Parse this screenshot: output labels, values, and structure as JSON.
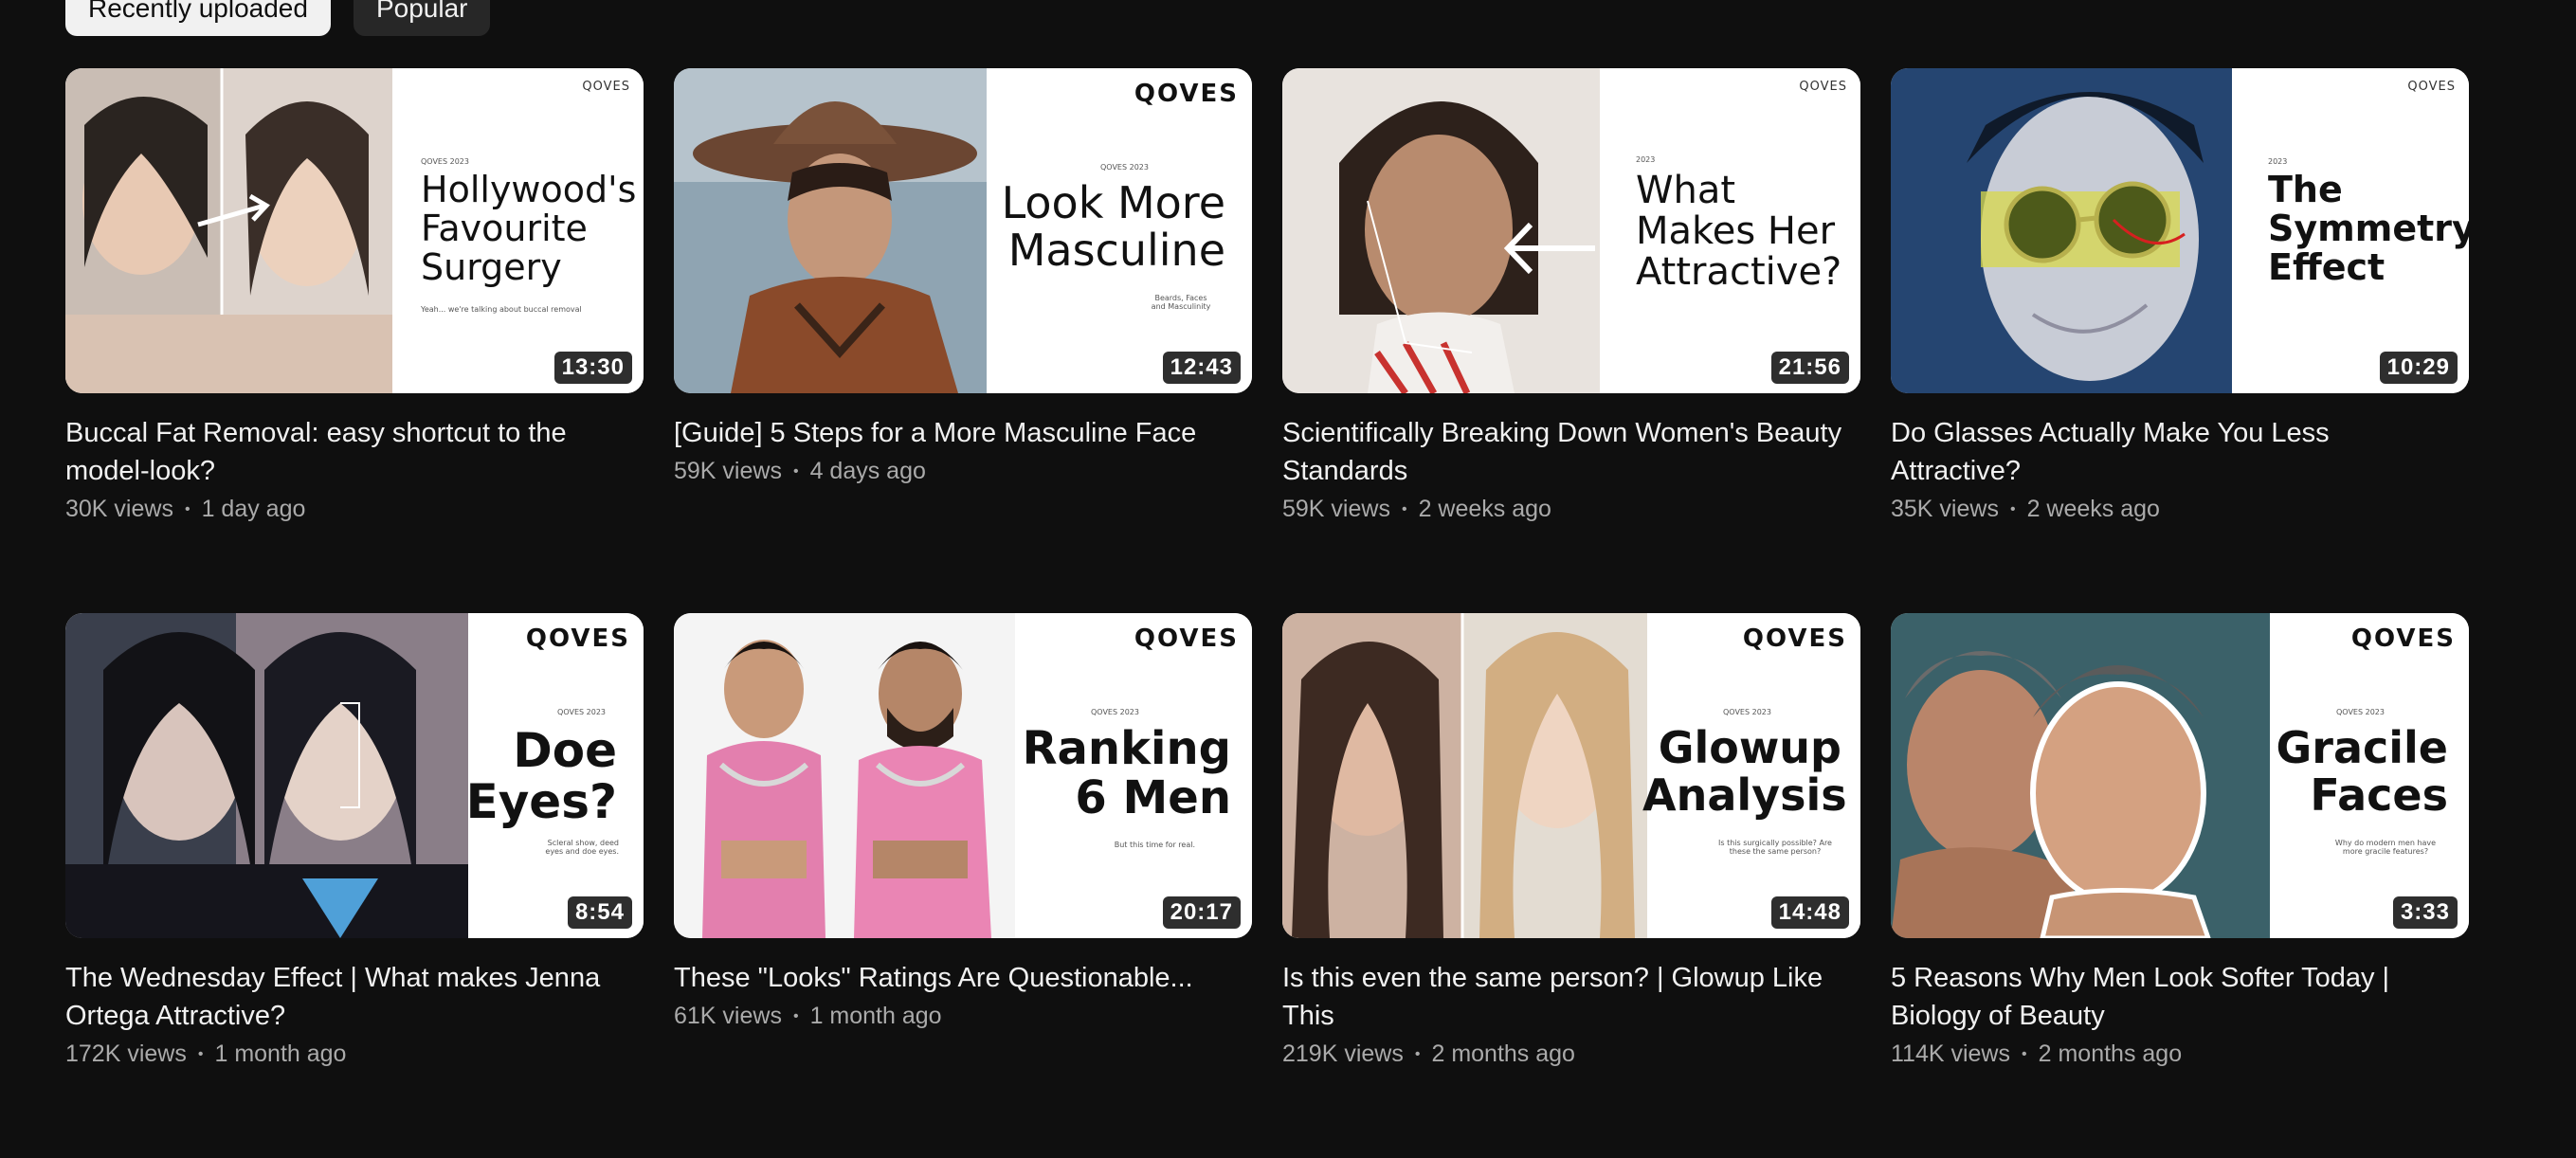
{
  "chips": [
    {
      "label": "Recently uploaded",
      "active": true
    },
    {
      "label": "Popular",
      "active": false
    }
  ],
  "videos": [
    {
      "title": "Buccal Fat Removal: easy shortcut to the model-look?",
      "views": "30K views",
      "age": "1 day ago",
      "duration": "13:30",
      "brand": "QOVES",
      "thumb_text": "Hollywood's Favourite Surgery",
      "thumb_small": "QOVES 2023",
      "thumb_caption": "Yeah... we're talking about buccal removal",
      "photo_color": "#b9a496"
    },
    {
      "title": "[Guide] 5 Steps for a More Masculine Face",
      "views": "59K views",
      "age": "4 days ago",
      "duration": "12:43",
      "brand": "QOVES",
      "thumb_text": "Look More Masculine",
      "thumb_small": "QOVES 2023",
      "thumb_caption": "Beards, Faces and Masculinity",
      "photo_color": "#6e5a4a"
    },
    {
      "title": "Scientifically Breaking Down Women's Beauty Standards",
      "views": "59K views",
      "age": "2 weeks ago",
      "duration": "21:56",
      "brand": "QOVES",
      "thumb_text": "What Makes Her Attractive?",
      "thumb_small": "2023",
      "thumb_caption": "",
      "photo_color": "#cdb7a4"
    },
    {
      "title": "Do Glasses Actually Make You Less Attractive?",
      "views": "35K views",
      "age": "2 weeks ago",
      "duration": "10:29",
      "brand": "QOVES",
      "thumb_text": "The Symmetry Effect",
      "thumb_small": "2023",
      "thumb_caption": "",
      "photo_color": "#2d4e7a"
    },
    {
      "title": "The Wednesday Effect | What makes Jenna Ortega Attractive?",
      "views": "172K views",
      "age": "1 month ago",
      "duration": "8:54",
      "brand": "QOVES",
      "thumb_text": "Doe Eyes?",
      "thumb_small": "QOVES 2023",
      "thumb_caption": "Scleral show, deed eyes and doe eyes.",
      "photo_color": "#2b2f3a"
    },
    {
      "title": "These \"Looks\" Ratings Are Questionable...",
      "views": "61K views",
      "age": "1 month ago",
      "duration": "20:17",
      "brand": "QOVES",
      "thumb_text": "Ranking 6 Men",
      "thumb_small": "QOVES 2023",
      "thumb_caption": "But this time for real.",
      "photo_color": "#d7d7d7"
    },
    {
      "title": "Is this even the same person? | Glowup Like This",
      "views": "219K views",
      "age": "2 months ago",
      "duration": "14:48",
      "brand": "QOVES",
      "thumb_text": "Glowup Analysis",
      "thumb_small": "QOVES 2023",
      "thumb_caption": "Is this surgically possible? Are these the same person?",
      "photo_color": "#b89a86"
    },
    {
      "title": "5 Reasons Why Men Look Softer Today | Biology of Beauty",
      "views": "114K views",
      "age": "2 months ago",
      "duration": "3:33",
      "brand": "QOVES",
      "thumb_text": "Gracile Faces",
      "thumb_small": "QOVES 2023",
      "thumb_caption": "Why do modern men have more gracile features?",
      "photo_color": "#4c6a6e"
    }
  ]
}
